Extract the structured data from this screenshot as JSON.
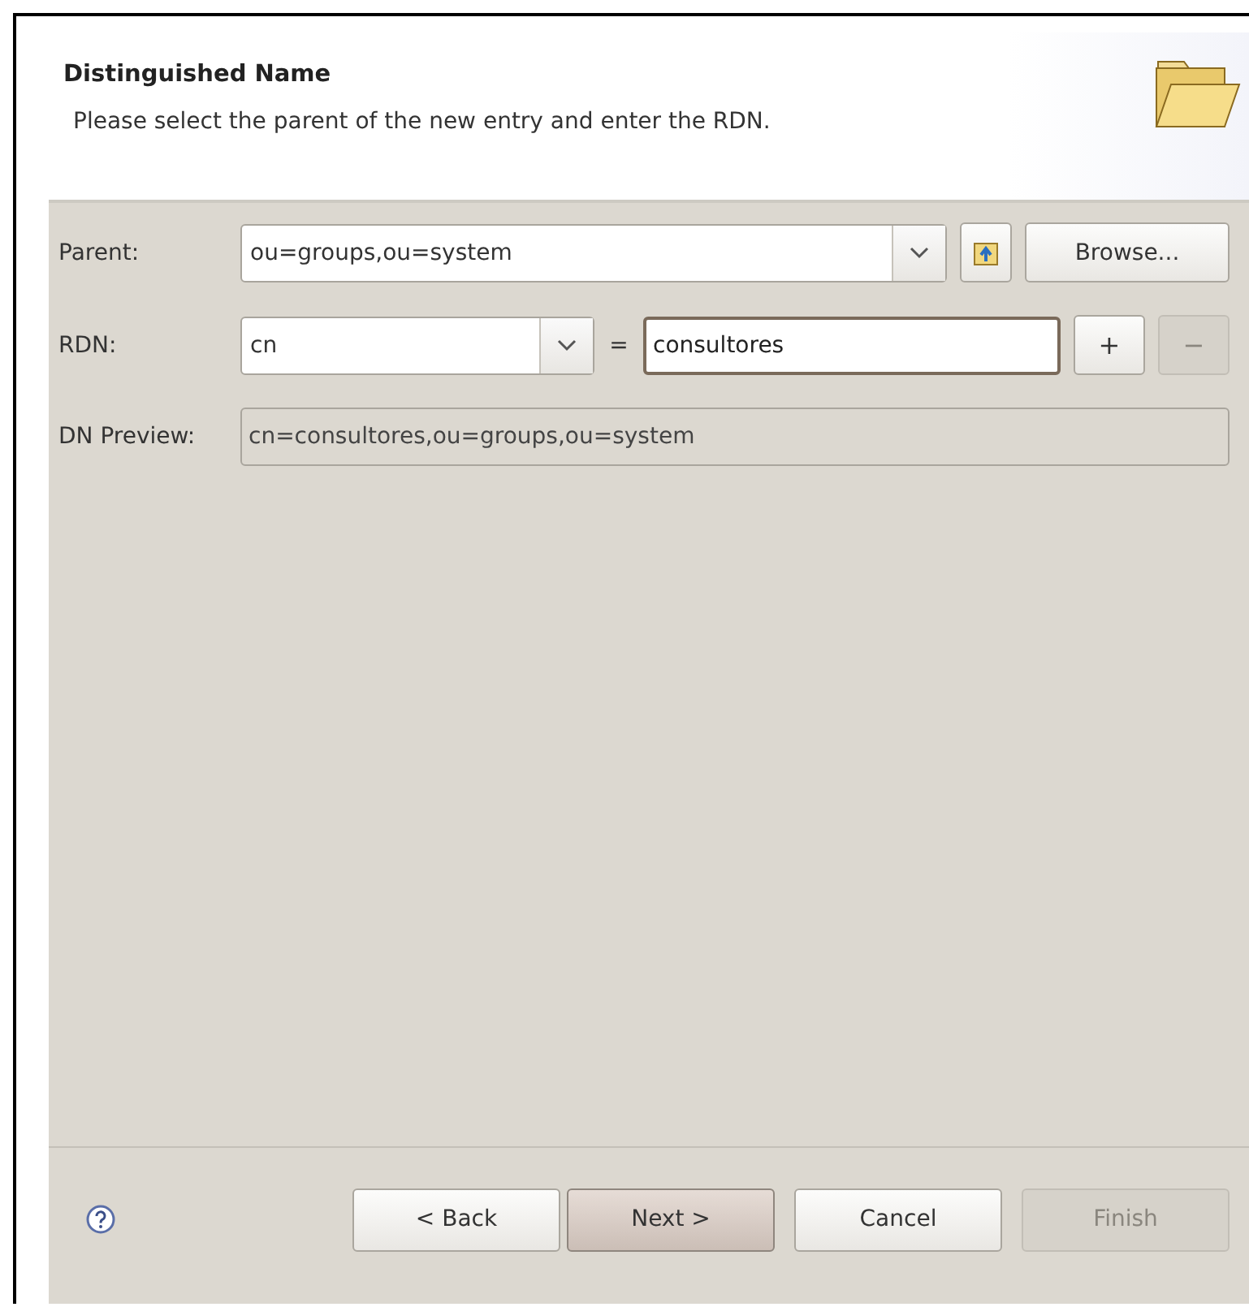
{
  "header": {
    "title": "Distinguished Name",
    "description": "Please select the parent of the new entry and enter the RDN."
  },
  "parent": {
    "label": "Parent:",
    "value": "ou=groups,ou=system",
    "browse": {
      "label": "Browse..."
    }
  },
  "rdn": {
    "label": "RDN:",
    "type_value": "cn",
    "equals": "=",
    "value": "consultores",
    "focused": true,
    "add": {
      "label": "+",
      "disabled": false
    },
    "remove": {
      "label": "−",
      "disabled": true
    }
  },
  "preview": {
    "label": "DN Preview:",
    "value": "cn=consultores,ou=groups,ou=system"
  },
  "buttons": [
    {
      "label": "< Back",
      "default": false,
      "disabled": false
    },
    {
      "label": "Next >",
      "default": true,
      "disabled": false
    },
    {
      "label": "Cancel",
      "default": false,
      "disabled": false
    },
    {
      "label": "Finish",
      "default": false,
      "disabled": true
    }
  ]
}
